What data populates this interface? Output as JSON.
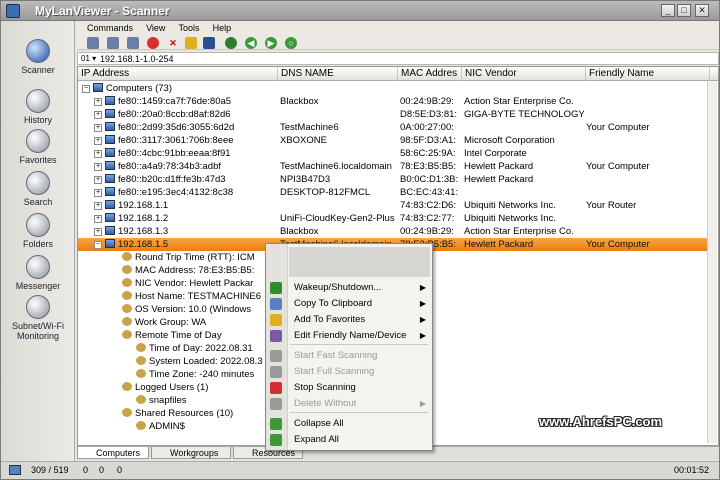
{
  "window": {
    "title": "MyLanViewer - Scanner"
  },
  "menu": [
    "Commands",
    "View",
    "Tools",
    "Help"
  ],
  "range": {
    "selector": "01",
    "value": "192.168.1-1.0-254"
  },
  "sidebar": [
    {
      "label": "Scanner",
      "icon": "scanner-icon"
    },
    {
      "label": "History",
      "icon": "history-icon"
    },
    {
      "label": "Favorites",
      "icon": "star-icon"
    },
    {
      "label": "Search",
      "icon": "search-icon"
    },
    {
      "label": "Folders",
      "icon": "folder-icon"
    },
    {
      "label": "Messenger",
      "icon": "message-icon"
    },
    {
      "label": "Subnet/Wi-Fi",
      "label2": "Monitoring",
      "icon": "wifi-icon"
    }
  ],
  "columns": [
    "IP Address",
    "DNS NAME",
    "MAC Addres",
    "NIC Vendor",
    "Friendly Name"
  ],
  "root": "Computers (73)",
  "hosts": [
    {
      "ip": "fe80::1459:ca7f:76de:80a5",
      "dns": "Blackbox",
      "mac": "00:24:9B:29:",
      "vendor": "Action Star Enterprise Co.",
      "friendly": ""
    },
    {
      "ip": "fe80::20a0:8ccb:d8af:82d6",
      "dns": "",
      "mac": "D8:5E:D3:81:",
      "vendor": "GIGA-BYTE TECHNOLOGY",
      "friendly": ""
    },
    {
      "ip": "fe80::2d99:35d6:3055:6d2d",
      "dns": "TestMachine6",
      "mac": "0A:00:27:00:",
      "vendor": "",
      "friendly": "Your Computer"
    },
    {
      "ip": "fe80::3117:3061:706b:8eee",
      "dns": "XBOXONE",
      "mac": "98:5F:D3:A1:",
      "vendor": "Microsoft Corporation",
      "friendly": ""
    },
    {
      "ip": "fe80::4cbc:91bb:eeaa:8f91",
      "dns": "",
      "mac": "58:6C:25:9A:",
      "vendor": "Intel Corporate",
      "friendly": ""
    },
    {
      "ip": "fe80::a4a9:78:34b3:adbf",
      "dns": "TestMachine6.localdomain",
      "mac": "78:E3:B5:B5:",
      "vendor": "Hewlett Packard",
      "friendly": "Your Computer"
    },
    {
      "ip": "fe80::b20c:d1ff:fe3b:47d3",
      "dns": "NPI3B47D3",
      "mac": "B0:0C:D1:3B:",
      "vendor": "Hewlett Packard",
      "friendly": ""
    },
    {
      "ip": "fe80::e195:3ec4:4132:8c38",
      "dns": "DESKTOP-812FMCL",
      "mac": "BC:EC:43:41:",
      "vendor": "",
      "friendly": ""
    },
    {
      "ip": "192.168.1.1",
      "dns": "",
      "mac": "74:83:C2:D6:",
      "vendor": "Ubiquiti Networks Inc.",
      "friendly": "Your Router"
    },
    {
      "ip": "192.168.1.2",
      "dns": "UniFi-CloudKey-Gen2-Plus",
      "mac": "74:83:C2:77:",
      "vendor": "Ubiquiti Networks Inc.",
      "friendly": ""
    },
    {
      "ip": "192.168.1.3",
      "dns": "Blackbox",
      "mac": "00:24:9B:29:",
      "vendor": "Action Star Enterprise Co.",
      "friendly": ""
    },
    {
      "ip": "192.168.1.5",
      "dns": "TestMachine6.localdomain",
      "mac": "78:E3:B5:B5:",
      "vendor": "Hewlett Packard",
      "friendly": "Your Computer"
    }
  ],
  "details": [
    {
      "text": "Round Trip Time (RTT): ICM",
      "indent": 1
    },
    {
      "text": "MAC Address: 78:E3:B5:B5:",
      "indent": 1
    },
    {
      "text": "NIC Vendor: Hewlett Packar",
      "indent": 1
    },
    {
      "text": "Host Name: TESTMACHINE6",
      "indent": 1
    },
    {
      "text": "OS Version: 10.0 (Windows",
      "indent": 1
    },
    {
      "text": "Work Group: WA",
      "indent": 1
    },
    {
      "text": "Remote Time of Day",
      "indent": 1
    },
    {
      "text": "Time of Day: 2022.08.31",
      "indent": 2
    },
    {
      "text": "System Loaded: 2022.08.3",
      "indent": 2
    },
    {
      "text": "Time Zone: -240 minutes",
      "indent": 2
    },
    {
      "text": "Logged Users (1)",
      "indent": 1
    },
    {
      "text": "snapfiles",
      "indent": 2
    },
    {
      "text": "Shared Resources (10)",
      "indent": 1
    },
    {
      "text": "ADMIN$",
      "indent": 2
    }
  ],
  "context_menu": [
    {
      "label": "Wakeup/Shutdown...",
      "arrow": true,
      "disabled": false,
      "color": "#2f8f2f"
    },
    {
      "label": "Copy To Clipboard",
      "arrow": true,
      "disabled": false,
      "color": "#5a7fc0"
    },
    {
      "label": "Add To Favorites",
      "arrow": true,
      "disabled": false,
      "color": "#e0b020"
    },
    {
      "label": "Edit Friendly Name/Device",
      "arrow": true,
      "disabled": false,
      "color": "#7a5aa0"
    },
    {
      "label": "Start Fast Scanning",
      "arrow": false,
      "disabled": true,
      "color": "#999999"
    },
    {
      "label": "Start Full Scanning",
      "arrow": false,
      "disabled": true,
      "color": "#999999"
    },
    {
      "label": "Stop Scanning",
      "arrow": false,
      "disabled": false,
      "color": "#d03030"
    },
    {
      "label": "Delete Without",
      "arrow": true,
      "disabled": true,
      "color": "#999999"
    },
    {
      "label": "Collapse All",
      "arrow": false,
      "disabled": false,
      "color": "#3a9a3a"
    },
    {
      "label": "Expand All",
      "arrow": false,
      "disabled": false,
      "color": "#3a9a3a"
    }
  ],
  "tabs": [
    "Computers",
    "Workgroups",
    "Resources"
  ],
  "status": {
    "count": "309 / 519",
    "a": "0",
    "b": "0",
    "c": "0",
    "time": "00:01:52"
  },
  "watermark": "www.AhrefsPC.com"
}
